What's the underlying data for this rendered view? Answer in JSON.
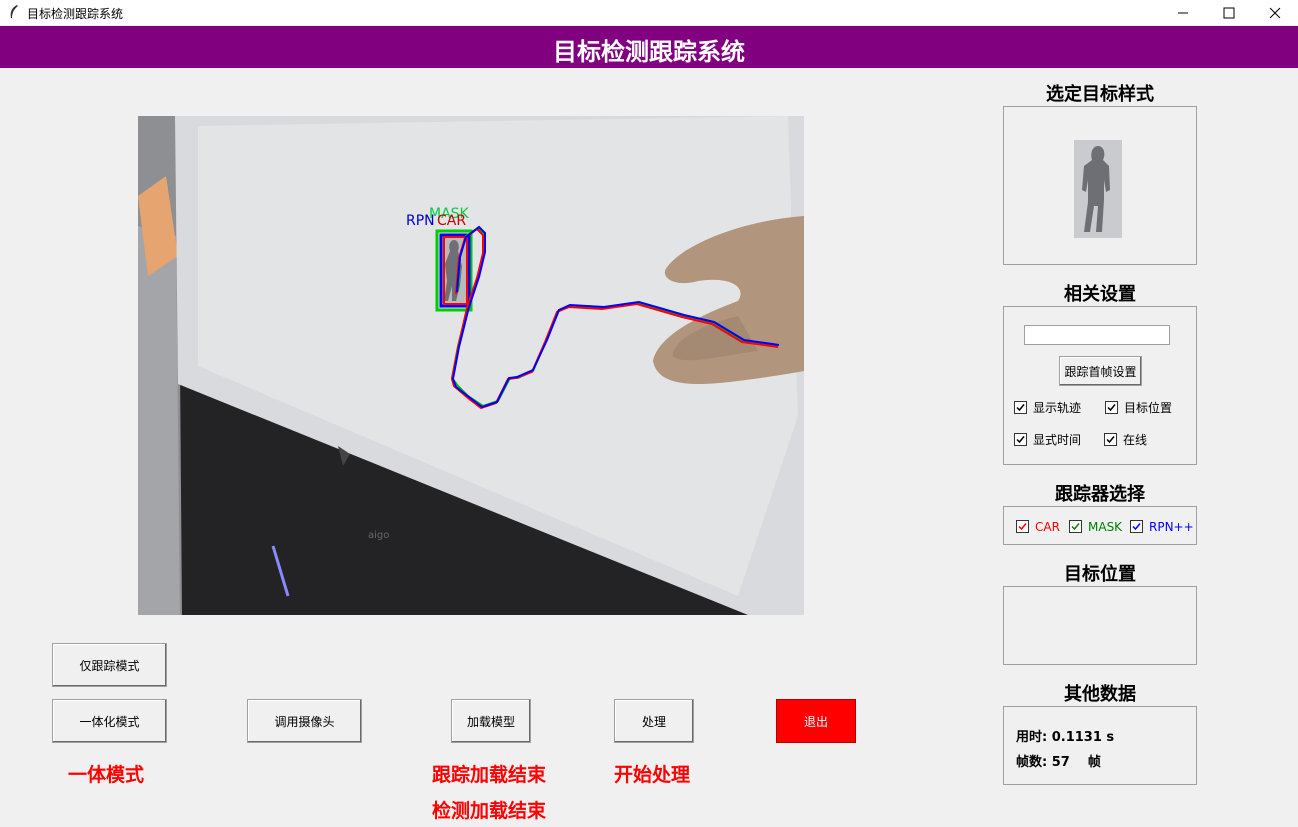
{
  "window": {
    "title": "目标检测跟踪系统"
  },
  "header": {
    "title": "目标检测跟踪系统"
  },
  "video": {
    "labels": {
      "rpn": "RPN",
      "car": "CAR",
      "mask": "MASK"
    }
  },
  "buttons": {
    "track_only": "仅跟踪模式",
    "integrated": "一体化模式",
    "camera": "调用摄像头",
    "load_model": "加载模型",
    "process": "处理",
    "exit": "退出"
  },
  "status": {
    "mode": "一体模式",
    "track_loaded": "跟踪加载结束",
    "detect_loaded": "检测加载结束",
    "processing": "开始处理"
  },
  "right_panel": {
    "target_sample_title": "选定目标样式",
    "settings_title": "相关设置",
    "settings_input": "",
    "first_frame_button": "跟踪首帧设置",
    "options": {
      "show_trajectory": {
        "label": "显示轨迹",
        "checked": true
      },
      "target_position": {
        "label": "目标位置",
        "checked": true
      },
      "show_time": {
        "label": "显式时间",
        "checked": true
      },
      "online": {
        "label": "在线",
        "checked": true
      }
    },
    "tracker_title": "跟踪器选择",
    "trackers": {
      "car": {
        "label": "CAR",
        "color": "#ff0000",
        "checked": true
      },
      "mask": {
        "label": "MASK",
        "color": "#008000",
        "checked": true
      },
      "rpn": {
        "label": "RPN++",
        "color": "#0000ff",
        "checked": true
      }
    },
    "position_title": "目标位置",
    "position_value": "",
    "other_title": "其他数据",
    "time_label": "用时: 0.1131 s",
    "frames_label": "帧数: 57    帧"
  }
}
